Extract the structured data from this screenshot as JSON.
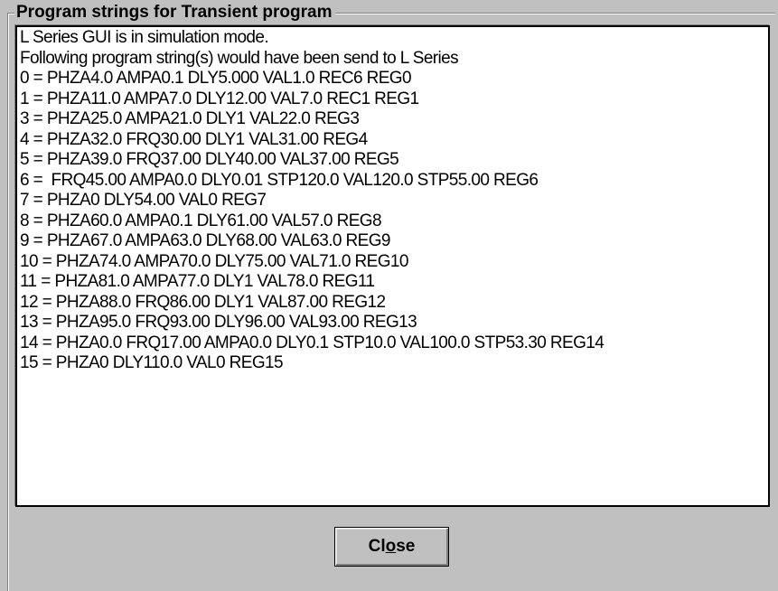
{
  "dialog": {
    "group_title": "Program strings for Transient program",
    "lines": [
      "L Series GUI is in simulation mode.",
      "Following program string(s) would have been send to L Series",
      "0 = PHZA4.0 AMPA0.1 DLY5.000 VAL1.0 REC6 REG0",
      "1 = PHZA11.0 AMPA7.0 DLY12.00 VAL7.0 REC1 REG1",
      "3 = PHZA25.0 AMPA21.0 DLY1 VAL22.0 REG3",
      "4 = PHZA32.0 FRQ30.00 DLY1 VAL31.00 REG4",
      "5 = PHZA39.0 FRQ37.00 DLY40.00 VAL37.00 REG5",
      "6 =  FRQ45.00 AMPA0.0 DLY0.01 STP120.0 VAL120.0 STP55.00 REG6",
      "7 = PHZA0 DLY54.00 VAL0 REG7",
      "8 = PHZA60.0 AMPA0.1 DLY61.00 VAL57.0 REG8",
      "9 = PHZA67.0 AMPA63.0 DLY68.00 VAL63.0 REG9",
      "10 = PHZA74.0 AMPA70.0 DLY75.00 VAL71.0 REG10",
      "11 = PHZA81.0 AMPA77.0 DLY1 VAL78.0 REG11",
      "12 = PHZA88.0 FRQ86.00 DLY1 VAL87.00 REG12",
      "13 = PHZA95.0 FRQ93.00 DLY96.00 VAL93.00 REG13",
      "14 = PHZA0.0 FRQ17.00 AMPA0.0 DLY0.1 STP10.0 VAL100.0 STP53.30 REG14",
      "15 = PHZA0 DLY110.0 VAL0 REG15"
    ],
    "close_button": {
      "label_before": "Cl",
      "label_mnemonic": "o",
      "label_after": "se"
    }
  },
  "colors": {
    "window_bg": "#c0c0c0",
    "text_bg": "#ffffff",
    "text": "#000000"
  }
}
